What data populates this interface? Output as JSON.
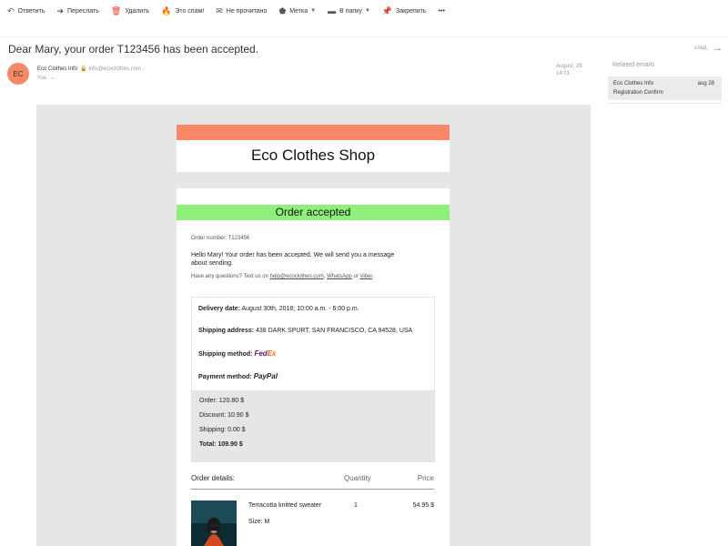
{
  "toolbar": {
    "reply": "Ответить",
    "forward": "Переслать",
    "delete": "Удалить",
    "spam": "Это спам!",
    "unread": "Не прочитано",
    "label": "Метка",
    "folder": "В папку",
    "pin": "Закрепить",
    "more": "•••"
  },
  "email": {
    "subject": "Dear Mary, your order T123456 has been accepted.",
    "next_label": "след.",
    "avatar_initials": "EC",
    "sender_name": "Eco Clothes Info",
    "sender_email": "info@ecoclothes.com",
    "recipient": "You",
    "date_line1": "August, 29",
    "date_line2": "14:01"
  },
  "related": {
    "title": "Related emails",
    "items": [
      {
        "from": "Eco Clothes Info",
        "date": "aug 28",
        "subject": "Registration Confirm"
      }
    ]
  },
  "body": {
    "shop_name": "Eco Clothes Shop",
    "banner": "Order accepted",
    "order_number": "Order number: T123456",
    "hello": "Hello Mary! Your order has been accepted. We will send you a message about sending.",
    "questions_prefix": "Have any questions? Text us on ",
    "questions_email": "help@ecoclothes.com",
    "questions_sep1": ", ",
    "questions_whatsapp": "WhatsApp",
    "questions_sep2": " or ",
    "questions_viber": "Viber",
    "questions_end": ".",
    "delivery_label": "Delivery date:",
    "delivery_value": " August 30th, 2018; 10:00 a.m. - 6:00 p.m.",
    "address_label": "Shipping address:",
    "address_value": " 438 DARK SPURT, SAN FRANCISCO, CA 94528,  USA",
    "shipping_method_label": "Shipping method:",
    "shipping_fe": "Fed",
    "shipping_ex": "Ex",
    "payment_label": "Payment method:",
    "payment_value": "PayPal",
    "order_total": "Order: 120.80 $",
    "discount": "Discount: 10.90 $",
    "shipping": "Shipping: 0.00 $",
    "total": "Total: 109.90 $",
    "details_label": "Order details:",
    "quantity_label": "Quantity",
    "price_label": "Price",
    "product": {
      "name": "Terracotta knitted sweater",
      "quantity": "1",
      "price": "54.95 $",
      "size": "Size: M"
    }
  },
  "colors": {
    "accent": "#f88866",
    "banner": "#8ef07a"
  }
}
